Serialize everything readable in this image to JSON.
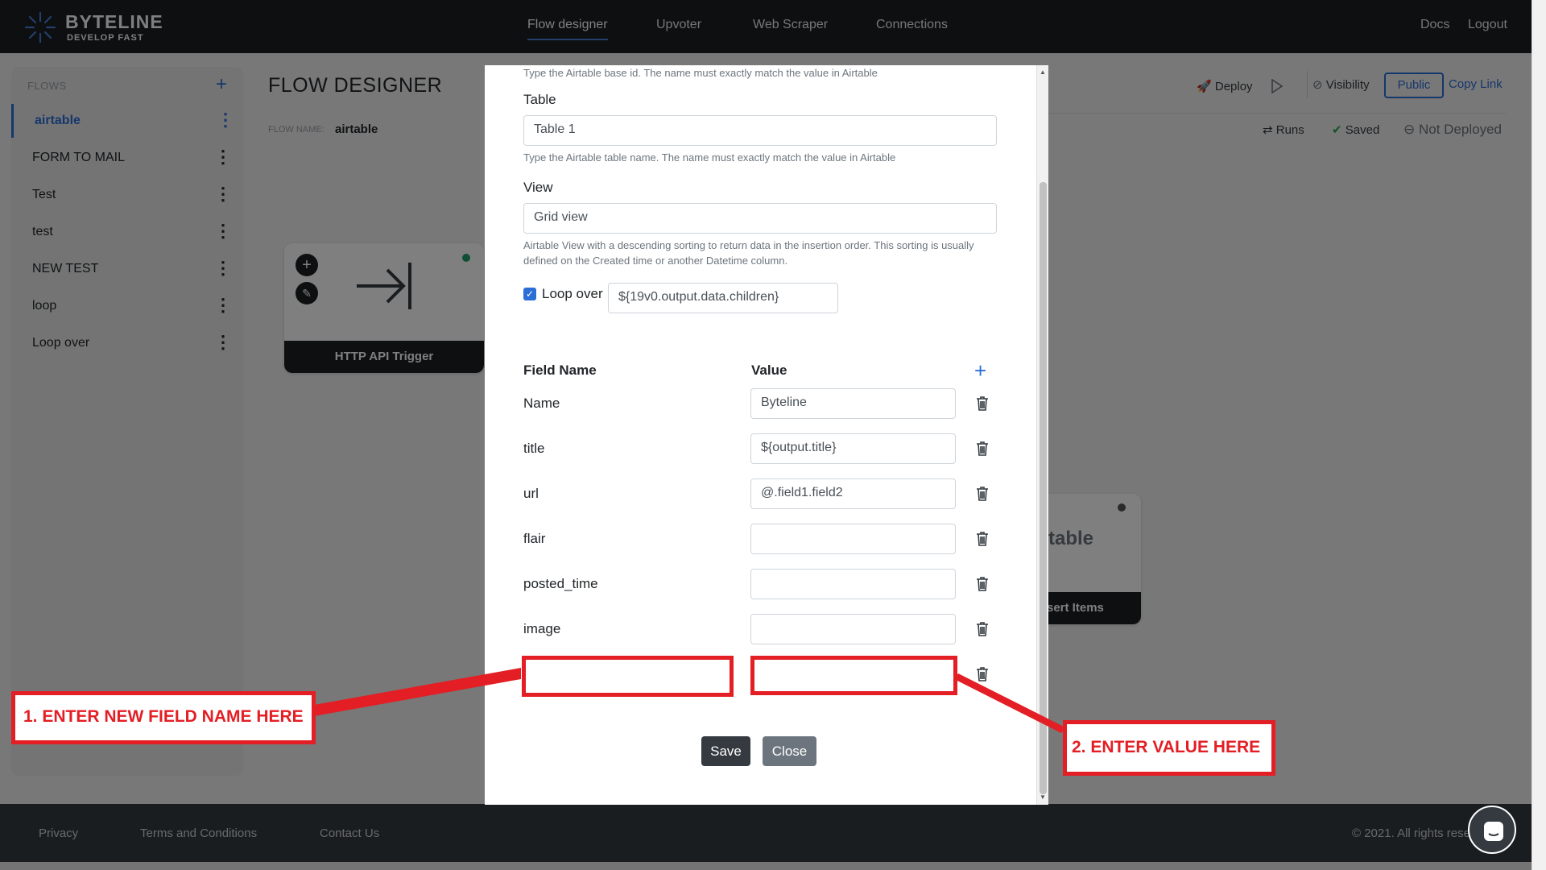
{
  "brand": {
    "name": "BYTELINE",
    "tagline": "DEVELOP FAST"
  },
  "nav": {
    "links": [
      "Flow designer",
      "Upvoter",
      "Web Scraper",
      "Connections"
    ],
    "right": [
      "Docs",
      "Logout"
    ]
  },
  "sidebar": {
    "header": "FLOWS",
    "add": "+",
    "items": [
      "airtable",
      "FORM TO MAIL",
      "Test",
      "test",
      "NEW TEST",
      "loop",
      "Loop over"
    ],
    "menu": "⋮"
  },
  "main": {
    "title": "FLOW DESIGNER",
    "flow_name_label": "FLOW NAME:",
    "flow_name": "airtable",
    "toolbar": {
      "deploy": "Deploy",
      "visibility": "Visibility",
      "public": "Public",
      "copy_link": "Copy Link",
      "runs": "Runs",
      "saved": "Saved",
      "status": "Not Deployed"
    },
    "nodes": {
      "trigger": "HTTP API Trigger",
      "airtable_logo": "table",
      "airtable_label": "sert Items"
    }
  },
  "modal": {
    "base_help": "Type the Airtable base id. The name must exactly match the value in Airtable",
    "table_label": "Table",
    "table_value": "Table 1",
    "table_help": "Type the Airtable table name. The name must exactly match the value in Airtable",
    "view_label": "View",
    "view_value": "Grid view",
    "view_help": "Airtable View with a descending sorting to return data in the insertion order. This sorting is usually defined on the Created time or another Datetime column.",
    "loop_label": "Loop over",
    "loop_checked": true,
    "loop_value": "${19v0.output.data.children}",
    "col_field": "Field Name",
    "col_value": "Value",
    "fields": [
      {
        "name": "Name",
        "value": "Byteline"
      },
      {
        "name": "title",
        "value": "${output.title}"
      },
      {
        "name": "url",
        "value": "@.field1.field2"
      },
      {
        "name": "flair",
        "value": ""
      },
      {
        "name": "posted_time",
        "value": ""
      },
      {
        "name": "image",
        "value": ""
      }
    ],
    "save": "Save",
    "close": "Close"
  },
  "annotations": {
    "step1": "1. ENTER NEW FIELD NAME HERE",
    "step2": "2. ENTER VALUE HERE",
    "color": "#e31e24"
  },
  "footer": {
    "links": [
      "Privacy",
      "Terms and Conditions",
      "Contact Us"
    ],
    "copyright": "© 2021. All rights rese"
  },
  "colors": {
    "accent": "#2b6fd6",
    "dark": "#1b1f23",
    "success": "#28a745"
  }
}
